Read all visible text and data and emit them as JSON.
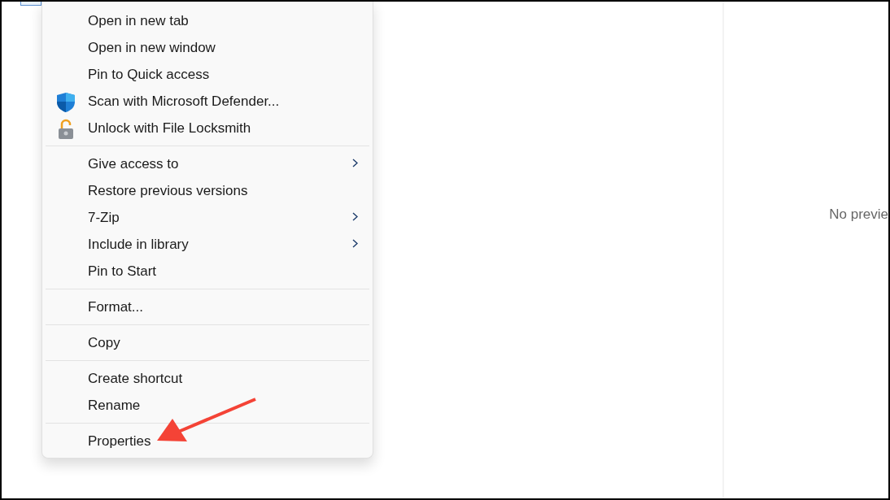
{
  "context_menu": {
    "groups": [
      {
        "items": [
          {
            "label": "Open in new tab",
            "submenu": false
          },
          {
            "label": "Open in new window",
            "submenu": false
          },
          {
            "label": "Pin to Quick access",
            "submenu": false
          },
          {
            "label": "Scan with Microsoft Defender...",
            "submenu": false,
            "kind": "shield"
          },
          {
            "label": "Unlock with File Locksmith",
            "submenu": false,
            "kind": "padlock"
          }
        ]
      },
      {
        "items": [
          {
            "label": "Give access to",
            "submenu": true
          },
          {
            "label": "Restore previous versions",
            "submenu": false
          },
          {
            "label": "7-Zip",
            "submenu": true
          },
          {
            "label": "Include in library",
            "submenu": true
          },
          {
            "label": "Pin to Start",
            "submenu": false
          }
        ]
      },
      {
        "items": [
          {
            "label": "Format...",
            "submenu": false
          }
        ]
      },
      {
        "items": [
          {
            "label": "Copy",
            "submenu": false
          }
        ]
      },
      {
        "items": [
          {
            "label": "Create shortcut",
            "submenu": false
          },
          {
            "label": "Rename",
            "submenu": false
          }
        ]
      },
      {
        "items": [
          {
            "label": "Properties",
            "submenu": false
          }
        ]
      }
    ]
  },
  "preview_pane": {
    "message": "No previe"
  }
}
